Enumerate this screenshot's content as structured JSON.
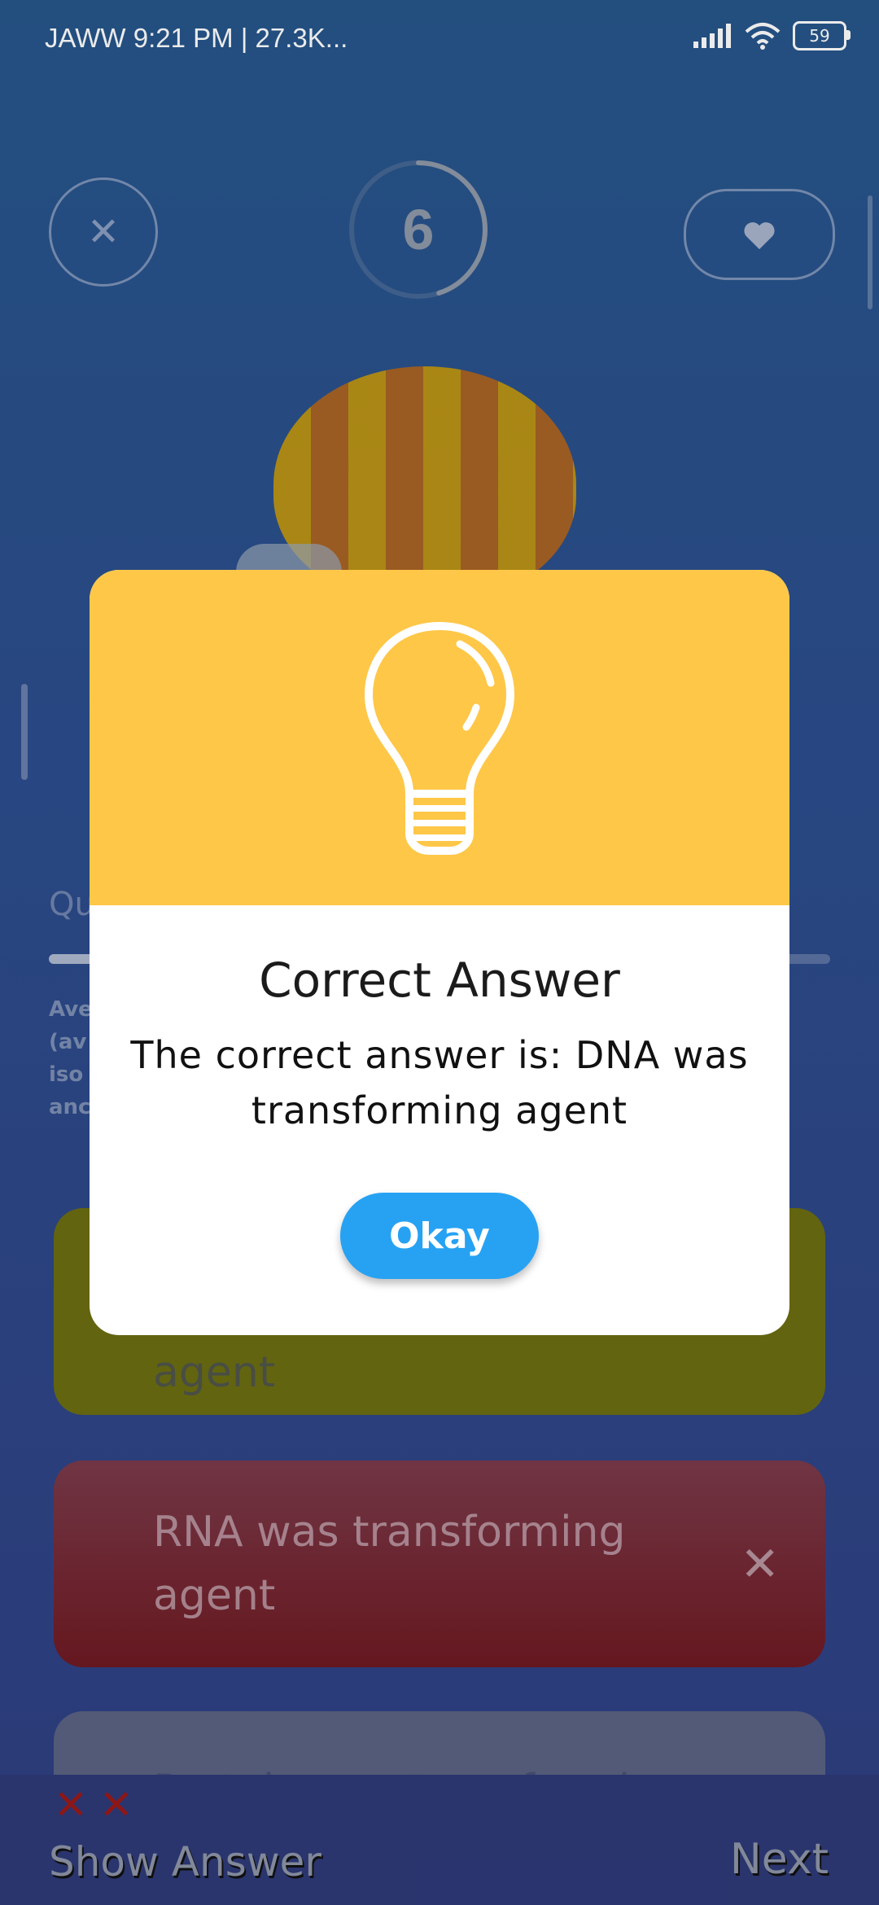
{
  "status_bar": {
    "left_text": "JAWW 9:21 PM | 27.3K...",
    "battery": "59",
    "icons": [
      "signal-icon",
      "wifi-icon",
      "battery-icon"
    ]
  },
  "top_bar": {
    "timer_value": "6",
    "timer_progress": 0.45,
    "close_icon": "close-icon",
    "heart_icon": "heart-icon"
  },
  "question": {
    "label": "Qu",
    "progress": 0.06,
    "text_fragments": [
      "Ave",
      "(av",
      "iso",
      "anc"
    ]
  },
  "options": [
    {
      "text": "agent",
      "state": "correct"
    },
    {
      "text": "RNA was transforming agent",
      "state": "wrong"
    },
    {
      "text": "Protein was transforming",
      "state": "neutral"
    }
  ],
  "bottom": {
    "strikes": "✕✕",
    "show_answer_label": "Show Answer",
    "next_label": "Next"
  },
  "dialog": {
    "icon": "lightbulb-icon",
    "title": "Correct Answer",
    "message": "The correct answer is: DNA was transforming agent",
    "button_label": "Okay",
    "header_color": "#fec748",
    "button_color": "#27a2f3"
  }
}
